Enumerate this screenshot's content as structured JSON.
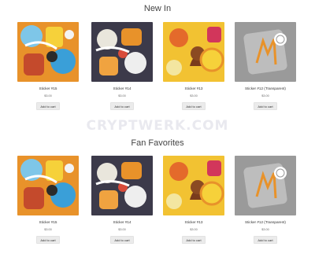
{
  "sections": [
    {
      "title": "New In",
      "products": [
        {
          "name": "Sticker #15",
          "price": "$3.00",
          "button": "Add to cart",
          "image": "sticker-collage-orange"
        },
        {
          "name": "Sticker #14",
          "price": "$3.00",
          "button": "Add to cart",
          "image": "sticker-collage-dark"
        },
        {
          "name": "Sticker #13",
          "price": "$3.00",
          "button": "Add to cart",
          "image": "sticker-collage-yellow"
        },
        {
          "name": "Sticker #12 (Transparent)",
          "price": "$3.00",
          "button": "Add to cart",
          "image": "sticker-transparent-bitcoin"
        }
      ]
    },
    {
      "title": "Fan Favorites",
      "products": [
        {
          "name": "Sticker #15",
          "price": "$3.00",
          "button": "Add to cart",
          "image": "sticker-collage-orange"
        },
        {
          "name": "Sticker #14",
          "price": "$3.00",
          "button": "Add to cart",
          "image": "sticker-collage-dark"
        },
        {
          "name": "Sticker #13",
          "price": "$3.00",
          "button": "Add to cart",
          "image": "sticker-collage-yellow"
        },
        {
          "name": "Sticker #12 (Transparent)",
          "price": "$3.00",
          "button": "Add to cart",
          "image": "sticker-transparent-bitcoin"
        }
      ]
    }
  ],
  "watermark": "CRYPTWERK.COM",
  "colors": {
    "accent_orange": "#e8922a",
    "accent_yellow": "#f2c232",
    "button_bg": "#ebebeb"
  }
}
